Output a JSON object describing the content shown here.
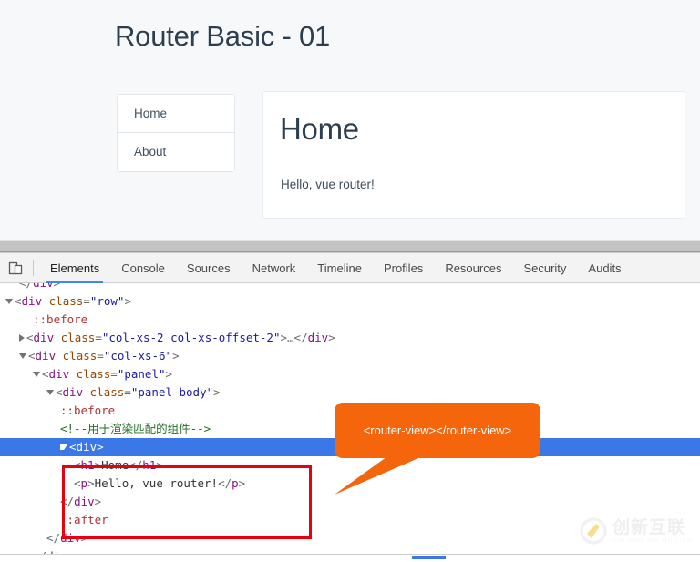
{
  "page": {
    "title": "Router Basic - 01",
    "nav": {
      "items": [
        {
          "label": "Home"
        },
        {
          "label": "About"
        }
      ]
    },
    "panel": {
      "heading": "Home",
      "paragraph": "Hello, vue router!"
    }
  },
  "devtools": {
    "device_toggle_icon": "device-toolbar-icon",
    "tabs": [
      {
        "label": "Elements",
        "active": true
      },
      {
        "label": "Console",
        "active": false
      },
      {
        "label": "Sources",
        "active": false
      },
      {
        "label": "Network",
        "active": false
      },
      {
        "label": "Timeline",
        "active": false
      },
      {
        "label": "Profiles",
        "active": false
      },
      {
        "label": "Resources",
        "active": false
      },
      {
        "label": "Security",
        "active": false
      },
      {
        "label": "Audits",
        "active": false
      }
    ],
    "dom_rows": [
      {
        "id": "r0",
        "indent": 1,
        "marker": "none",
        "text": "</div>",
        "kind": "close",
        "clipped": true
      },
      {
        "id": "r1",
        "indent": 0,
        "marker": "down",
        "text": "<div class=\"row\">",
        "kind": "open-attr",
        "tag": "div",
        "attr": "class",
        "value": "row"
      },
      {
        "id": "r2",
        "indent": 2,
        "marker": "none",
        "text": "::before",
        "kind": "pseudo"
      },
      {
        "id": "r3",
        "indent": 1,
        "marker": "right",
        "text": "<div class=\"col-xs-2 col-xs-offset-2\">…</div>",
        "kind": "collapsed",
        "tag": "div",
        "attr": "class",
        "value": "col-xs-2 col-xs-offset-2"
      },
      {
        "id": "r4",
        "indent": 1,
        "marker": "down",
        "text": "<div class=\"col-xs-6\">",
        "kind": "open-attr",
        "tag": "div",
        "attr": "class",
        "value": "col-xs-6"
      },
      {
        "id": "r5",
        "indent": 2,
        "marker": "down",
        "text": "<div class=\"panel\">",
        "kind": "open-attr",
        "tag": "div",
        "attr": "class",
        "value": "panel"
      },
      {
        "id": "r6",
        "indent": 3,
        "marker": "down",
        "text": "<div class=\"panel-body\">",
        "kind": "open-attr",
        "tag": "div",
        "attr": "class",
        "value": "panel-body"
      },
      {
        "id": "r7",
        "indent": 4,
        "marker": "none",
        "text": "::before",
        "kind": "pseudo"
      },
      {
        "id": "r8",
        "indent": 4,
        "marker": "none",
        "text": "<!--用于渲染匹配的组件-->",
        "kind": "comment"
      },
      {
        "id": "r9",
        "indent": 4,
        "marker": "down",
        "text": "<div>",
        "kind": "open",
        "tag": "div",
        "selected": true
      },
      {
        "id": "r10",
        "indent": 5,
        "marker": "none",
        "text": "<h1>Home</h1>",
        "kind": "element-text",
        "tag": "h1",
        "content": "Home"
      },
      {
        "id": "r11",
        "indent": 5,
        "marker": "none",
        "text": "<p>Hello, vue router!</p>",
        "kind": "element-text",
        "tag": "p",
        "content": "Hello, vue router!"
      },
      {
        "id": "r12",
        "indent": 4,
        "marker": "none",
        "text": "</div>",
        "kind": "close"
      },
      {
        "id": "r13",
        "indent": 4,
        "marker": "none",
        "text": "::after",
        "kind": "pseudo"
      },
      {
        "id": "r14",
        "indent": 3,
        "marker": "none",
        "text": "</div>",
        "kind": "close"
      },
      {
        "id": "r15",
        "indent": 2,
        "marker": "none",
        "text": "</div>",
        "kind": "close"
      }
    ],
    "scrollbar": {
      "orientation": "horizontal",
      "color": "#3b78e7"
    }
  },
  "annotations": {
    "callout": {
      "text": "<router-view></router-view>",
      "color": "#f4650c"
    },
    "highlight_box": {
      "color": "#e8000d"
    }
  },
  "watermark": {
    "cn": "创新互联",
    "pinyin": "CHUANG XIN HU LIAN"
  },
  "colors": {
    "accent_blue": "#3b78e7",
    "title_text": "#2c3e50",
    "page_bg": "#f7f8fa",
    "devtools_toolbar": "#f3f3f3",
    "splitter": "#c3c3c3"
  }
}
